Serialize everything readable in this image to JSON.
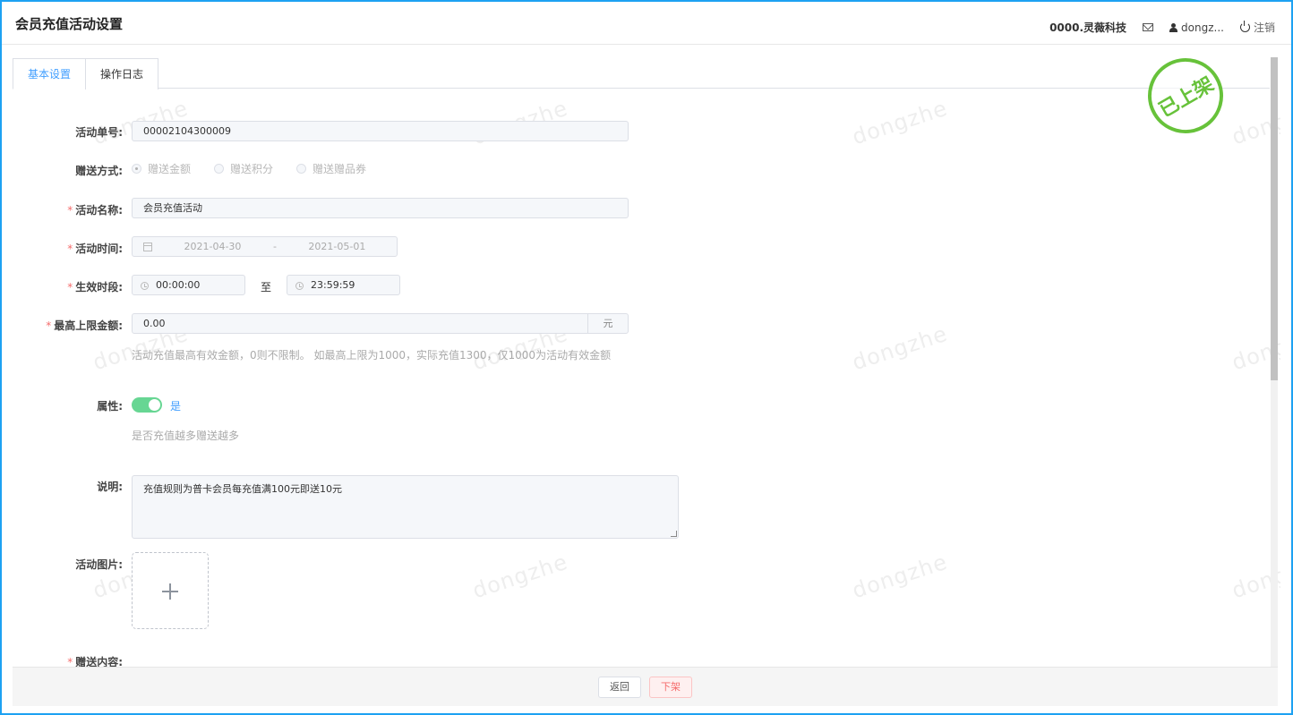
{
  "header": {
    "title": "会员充值活动设置",
    "company": "0000.灵薇科技",
    "user": "dongz...",
    "logout": "注销"
  },
  "tabs": [
    {
      "label": "基本设置",
      "active": true
    },
    {
      "label": "操作日志",
      "active": false
    }
  ],
  "watermark": "dongzhe",
  "stamp": "已上架",
  "form": {
    "activity_no": {
      "label": "活动单号:",
      "value": "00002104300009"
    },
    "gift_method": {
      "label": "赠送方式:",
      "options": [
        "赠送金额",
        "赠送积分",
        "赠送赠品券"
      ],
      "selected": "赠送金额"
    },
    "activity_name": {
      "label": "活动名称:",
      "value": "会员充值活动"
    },
    "activity_time": {
      "label": "活动时间:",
      "start": "2021-04-30",
      "separator": "-",
      "end": "2021-05-01"
    },
    "effective_period": {
      "label": "生效时段:",
      "start": "00:00:00",
      "to": "至",
      "end": "23:59:59"
    },
    "max_amount": {
      "label": "最高上限金额:",
      "value": "0.00",
      "unit": "元",
      "hint": "活动充值最高有效金额，0则不限制。 如最高上限为1000，实际充值1300，仅1000为活动有效金额"
    },
    "attribute": {
      "label": "属性:",
      "toggle_on": true,
      "toggle_text": "是",
      "hint": "是否充值越多赠送越多"
    },
    "description": {
      "label": "说明:",
      "value": "充值规则为普卡会员每充值满100元即送10元"
    },
    "image": {
      "label": "活动图片:"
    },
    "gift_content": {
      "label": "赠送内容:"
    }
  },
  "footer": {
    "back": "返回",
    "offline": "下架"
  },
  "colors": {
    "accent": "#409eff",
    "stamp": "#67c23a",
    "required": "#f56c6c",
    "toggle": "#67d693"
  }
}
